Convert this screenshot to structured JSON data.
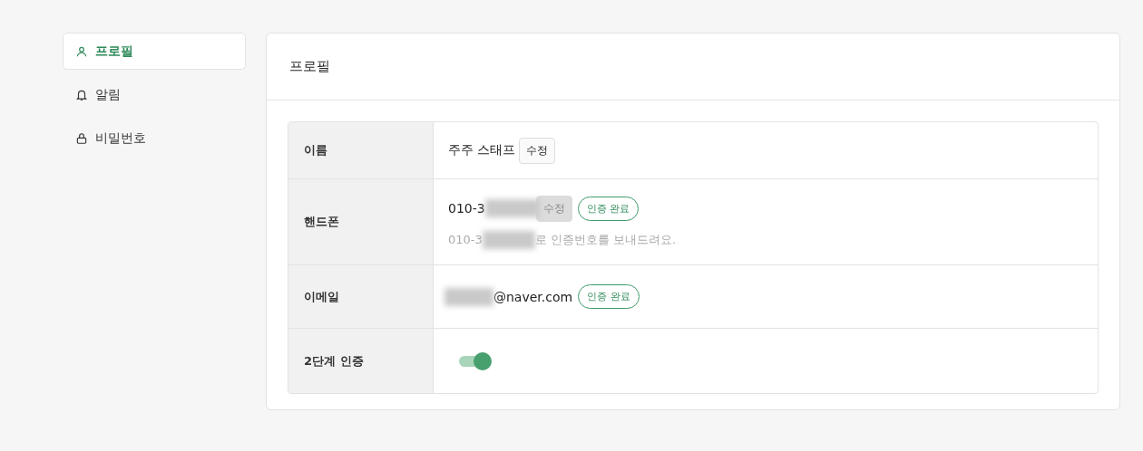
{
  "sidebar": {
    "items": [
      {
        "label": "프로필",
        "kind": "user",
        "selected": true
      },
      {
        "label": "알림",
        "kind": "bell",
        "selected": false
      },
      {
        "label": "비밀번호",
        "kind": "lock",
        "selected": false
      }
    ]
  },
  "card": {
    "title": "프로필",
    "rows": [
      {
        "kind": "name",
        "label": "이름",
        "value": "주주 스태프",
        "edit": {
          "label": "수정",
          "disabled": false
        }
      },
      {
        "kind": "phone",
        "label": "핸드폰",
        "value_prefix": "010-3",
        "edit": {
          "label": "수정",
          "disabled": true
        },
        "badge": "인증 완료",
        "hint_prefix": "010-3",
        "hint": "로 인증번호를 보내드려요."
      },
      {
        "kind": "email",
        "label": "이메일",
        "value_suffix": "@naver.com",
        "badge": "인증 완료"
      },
      {
        "kind": "toggle",
        "label": "2단계 인증",
        "on": true
      }
    ]
  }
}
